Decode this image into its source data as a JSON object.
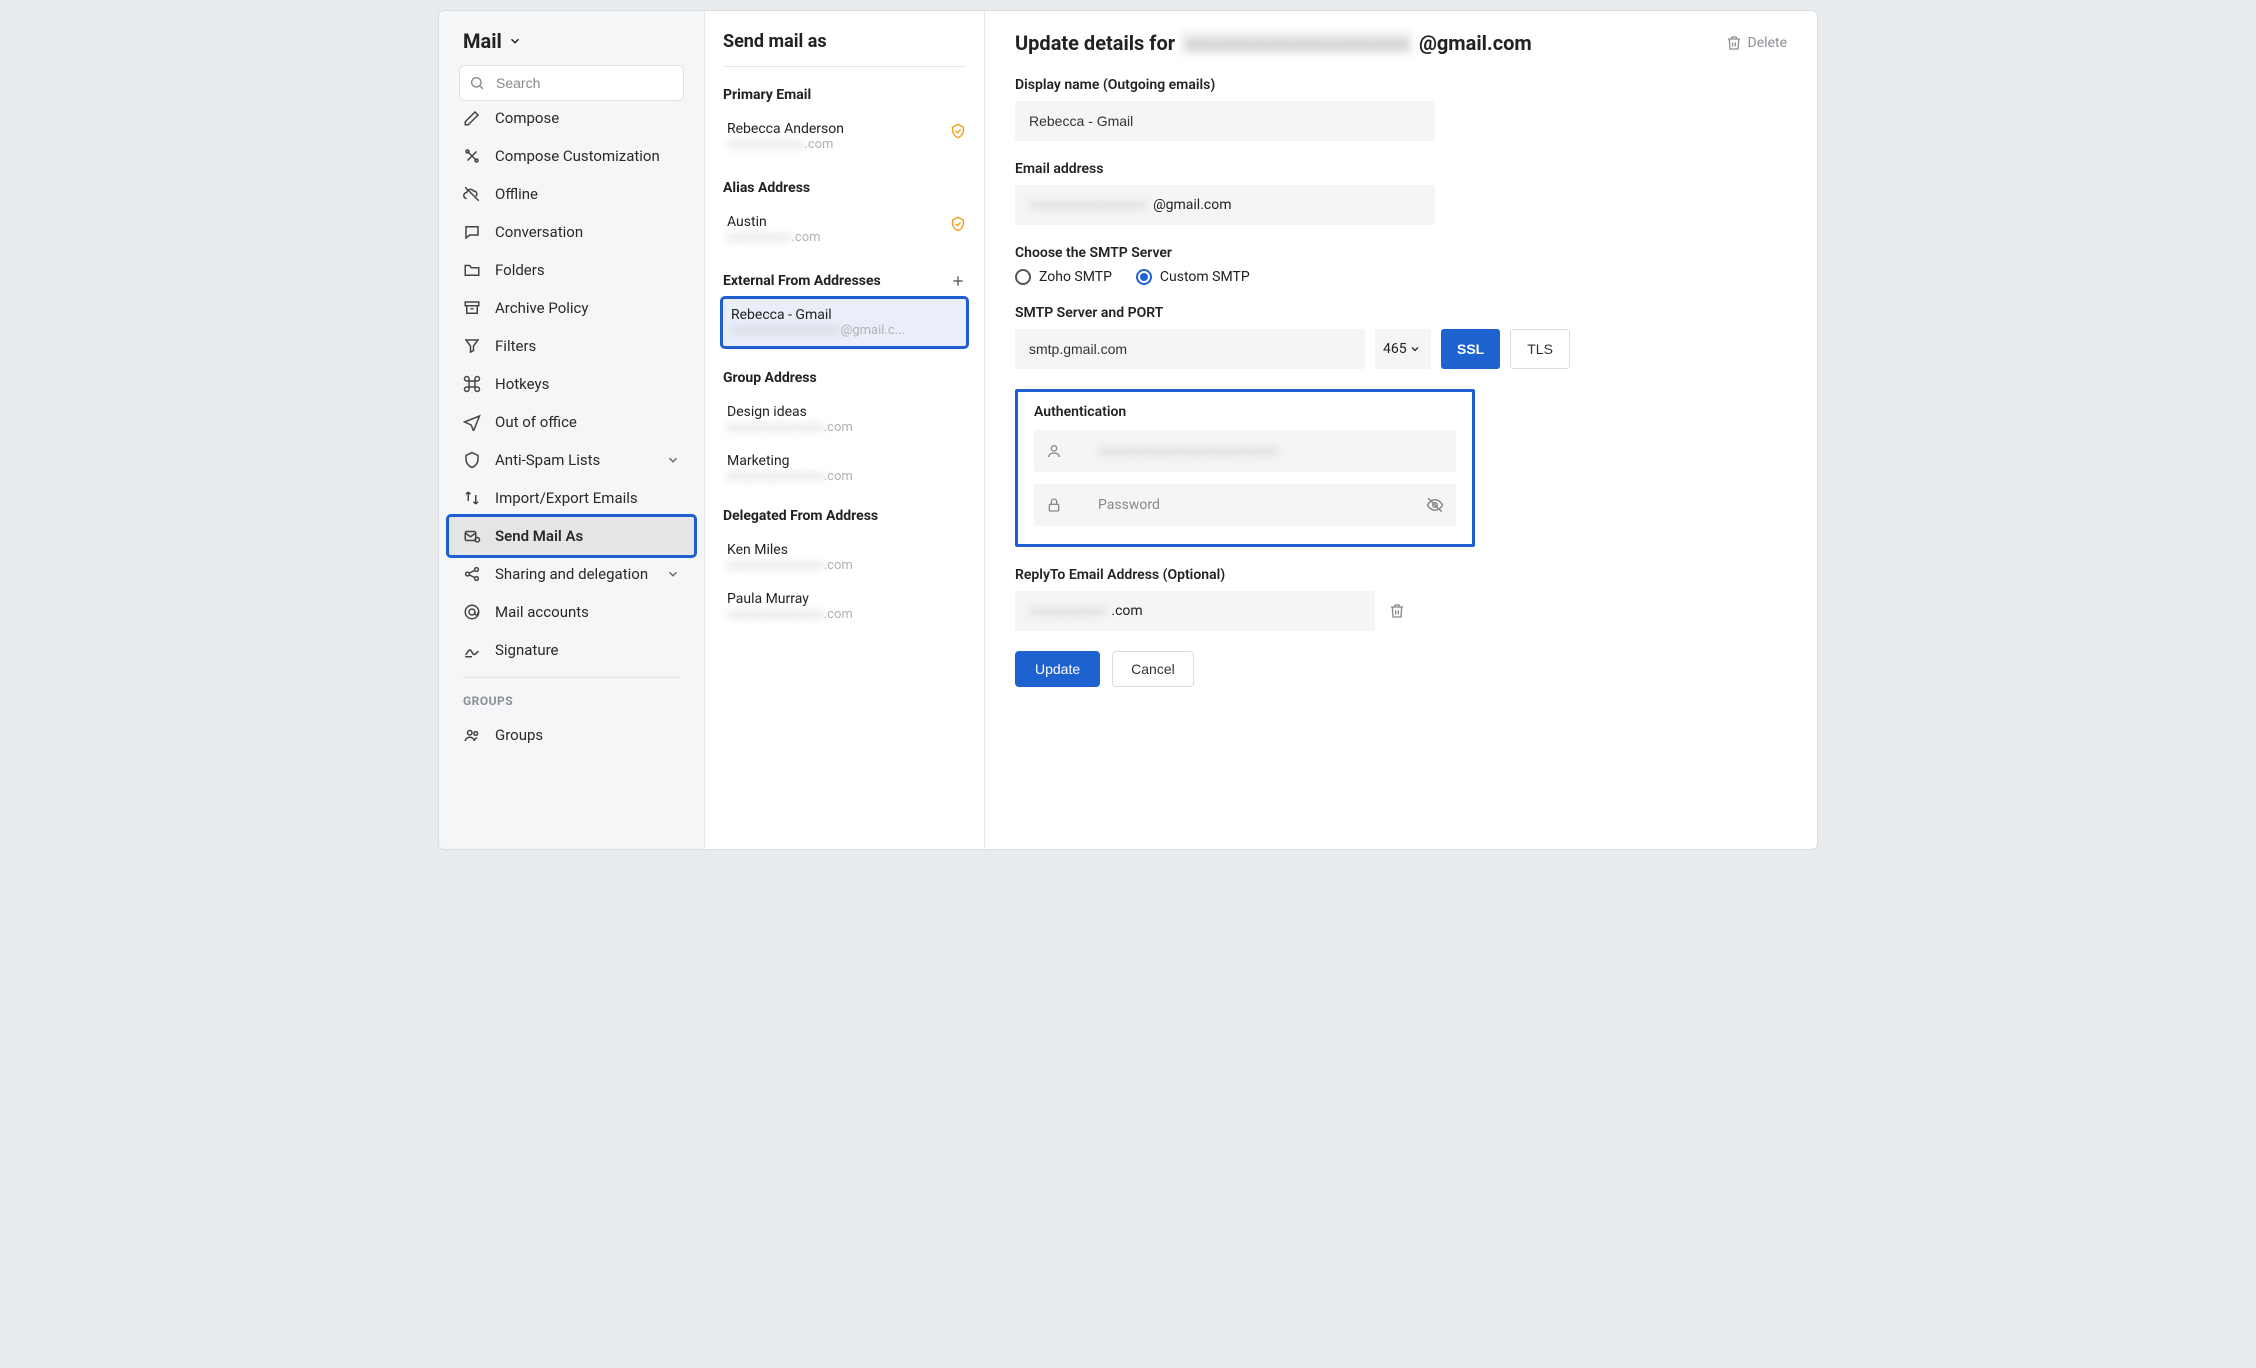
{
  "app": {
    "title": "Mail"
  },
  "search": {
    "placeholder": "Search"
  },
  "nav": {
    "items": [
      {
        "label": "Compose",
        "icon": "compose",
        "cutoff": true
      },
      {
        "label": "Compose Customization",
        "icon": "tools"
      },
      {
        "label": "Offline",
        "icon": "cloud-off"
      },
      {
        "label": "Conversation",
        "icon": "chat"
      },
      {
        "label": "Folders",
        "icon": "folder"
      },
      {
        "label": "Archive Policy",
        "icon": "archive"
      },
      {
        "label": "Filters",
        "icon": "funnel"
      },
      {
        "label": "Hotkeys",
        "icon": "command"
      },
      {
        "label": "Out of office",
        "icon": "plane"
      },
      {
        "label": "Anti-Spam Lists",
        "icon": "shield",
        "chev": true
      },
      {
        "label": "Import/Export Emails",
        "icon": "updown"
      },
      {
        "label": "Send Mail As",
        "icon": "sendas",
        "selected": true
      },
      {
        "label": "Sharing and delegation",
        "icon": "share",
        "chev": true
      },
      {
        "label": "Mail accounts",
        "icon": "at"
      },
      {
        "label": "Signature",
        "icon": "sign"
      }
    ],
    "groups_heading": "GROUPS",
    "groups_label": "Groups"
  },
  "middle": {
    "title": "Send mail as",
    "primary_label": "Primary Email",
    "primary": {
      "name": "Rebecca Anderson",
      "email_suffix": ".com",
      "shield": true
    },
    "alias_label": "Alias Address",
    "alias": {
      "name": "Austin",
      "email_suffix": ".com",
      "shield": true
    },
    "external_label": "External From Addresses",
    "external": {
      "name": "Rebecca - Gmail",
      "email_suffix": "@gmail.c..."
    },
    "group_label": "Group Address",
    "groups": [
      {
        "name": "Design ideas",
        "email_suffix": ".com"
      },
      {
        "name": "Marketing",
        "email_suffix": ".com"
      }
    ],
    "delegated_label": "Delegated From Address",
    "delegated": [
      {
        "name": "Ken Miles",
        "email_suffix": ".com"
      },
      {
        "name": "Paula Murray",
        "email_suffix": ".com"
      }
    ]
  },
  "detail": {
    "title_prefix": "Update details for",
    "title_suffix": "@gmail.com",
    "delete_label": "Delete",
    "display_name_label": "Display name (Outgoing emails)",
    "display_name_value": "Rebecca - Gmail",
    "email_label": "Email address",
    "email_suffix": "@gmail.com",
    "smtp_choose_label": "Choose the SMTP Server",
    "smtp_opt_zoho": "Zoho SMTP",
    "smtp_opt_custom": "Custom SMTP",
    "smtp_server_label": "SMTP Server and PORT",
    "smtp_server_value": "smtp.gmail.com",
    "smtp_port_value": "465",
    "ssl_label": "SSL",
    "tls_label": "TLS",
    "auth_label": "Authentication",
    "auth_password_placeholder": "Password",
    "replyto_label": "ReplyTo Email Address (Optional)",
    "replyto_suffix": ".com",
    "update_btn": "Update",
    "cancel_btn": "Cancel"
  }
}
